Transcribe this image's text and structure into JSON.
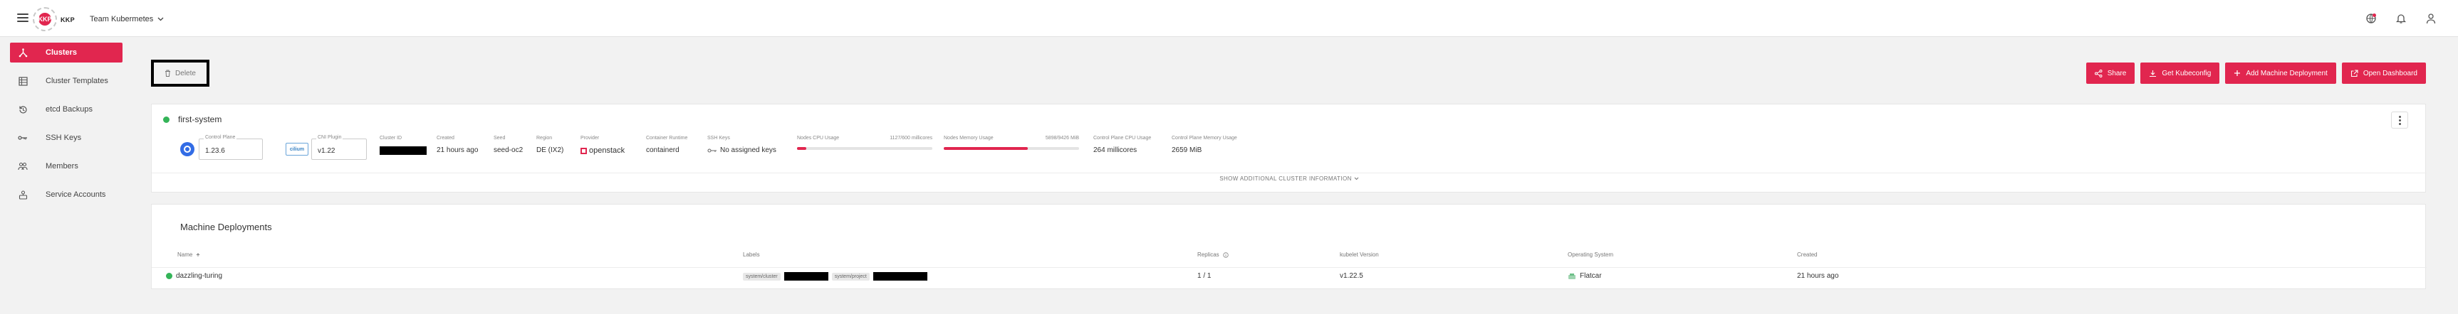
{
  "topbar": {
    "logo_text": "KKP",
    "logo_badge": "KKP",
    "project_name": "Team Kubermetes",
    "icons": [
      "menu-icon",
      "help-icon",
      "bell-icon",
      "user-icon"
    ]
  },
  "sidebar": {
    "items": [
      {
        "label": "Clusters",
        "icon": "clusters-icon",
        "active": true
      },
      {
        "label": "Cluster Templates",
        "icon": "templates-icon"
      },
      {
        "label": "etcd Backups",
        "icon": "backup-icon"
      },
      {
        "label": "SSH Keys",
        "icon": "key-icon"
      },
      {
        "label": "Members",
        "icon": "members-icon"
      },
      {
        "label": "Service Accounts",
        "icon": "service-accounts-icon"
      }
    ]
  },
  "toolbar": {
    "delete_label": "Delete",
    "share_label": "Share",
    "kubeconfig_label": "Get Kubeconfig",
    "add_md_label": "Add Machine Deployment",
    "dashboard_label": "Open Dashboard"
  },
  "cluster": {
    "name": "first-system",
    "status_color": "#34b458",
    "control_plane_label": "Control Plane",
    "control_plane_version": "1.23.6",
    "cni_label": "CNI Plugin",
    "cni_logo": "cilium",
    "cni_version": "v1.22",
    "cluster_id_label": "Cluster ID",
    "created_label": "Created",
    "created_value": "21 hours ago",
    "seed_label": "Seed",
    "seed_value": "seed-oc2",
    "region_label": "Region",
    "region_value": "DE (IX2)",
    "provider_label": "Provider",
    "provider_value": "openstack",
    "runtime_label": "Container Runtime",
    "runtime_value": "containerd",
    "ssh_label": "SSH Keys",
    "ssh_value": "No assigned keys",
    "cpu_label": "Nodes CPU Usage",
    "cpu_value": "1127/600 millicores",
    "cpu_percent": 7,
    "mem_label": "Nodes Memory Usage",
    "mem_value": "5898/9426 MiB",
    "mem_percent": 62,
    "cp_cpu_label": "Control Plane CPU Usage",
    "cp_cpu_value": "264 millicores",
    "cp_mem_label": "Control Plane Memory Usage",
    "cp_mem_value": "2659 MiB",
    "show_more": "SHOW ADDITIONAL CLUSTER INFORMATION"
  },
  "machine_deployments": {
    "title": "Machine Deployments",
    "columns": {
      "name": "Name",
      "labels": "Labels",
      "replicas": "Replicas",
      "kubelet": "kubelet Version",
      "os": "Operating System",
      "created": "Created"
    },
    "rows": [
      {
        "name": "dazzling-turing",
        "label_1": "system/cluster",
        "label_2": "system/project",
        "replicas": "1 / 1",
        "kubelet": "v1.22.5",
        "os": "Flatcar",
        "created": "21 hours ago"
      }
    ]
  },
  "colors": {
    "accent": "#e1264f",
    "success": "#34b458",
    "background": "#f2f2f2"
  }
}
